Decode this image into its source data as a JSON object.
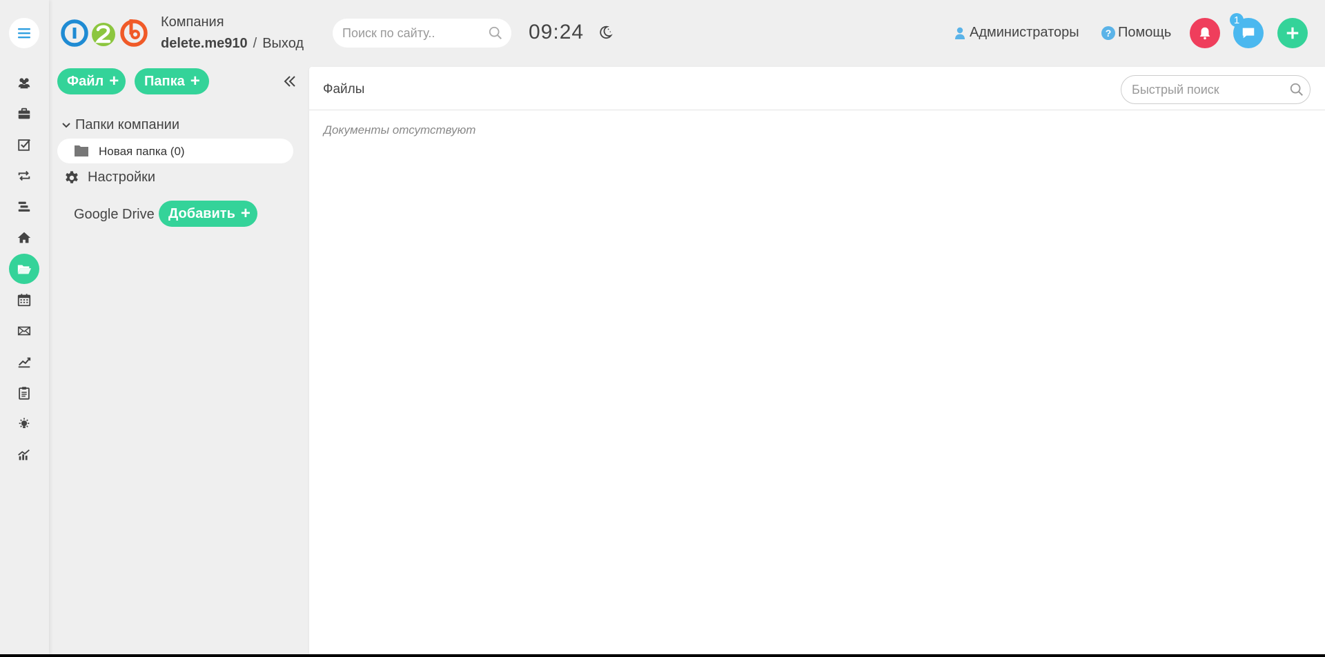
{
  "header": {
    "company_label": "Компания",
    "username": "delete.me910",
    "separator": "/",
    "logout_label": "Выход",
    "site_search_placeholder": "Поиск по сайту..",
    "clock": "09:24",
    "admins_label": "Администраторы",
    "help_label": "Помощь",
    "help_mark": "?",
    "chat_badge_count": "1"
  },
  "rail": {
    "items": [
      {
        "icon": "users-icon"
      },
      {
        "icon": "briefcase-icon"
      },
      {
        "icon": "checkbox-icon"
      },
      {
        "icon": "repeat-icon"
      },
      {
        "icon": "stack-icon"
      },
      {
        "icon": "home-icon"
      },
      {
        "icon": "folder-open-icon",
        "active": true
      },
      {
        "icon": "calendar-icon"
      },
      {
        "icon": "envelope-icon"
      },
      {
        "icon": "line-chart-icon"
      },
      {
        "icon": "clipboard-icon"
      },
      {
        "icon": "lightbulb-icon"
      },
      {
        "icon": "analytics-icon"
      }
    ]
  },
  "files_panel": {
    "file_button": "Файл",
    "folder_button": "Папка",
    "plus": "+",
    "tree_title": "Папки компании",
    "folder_item": "Новая папка (0)",
    "settings_label": "Настройки",
    "gdrive_label": "Google Drive",
    "add_button": "Добавить"
  },
  "main": {
    "title": "Файлы",
    "quick_search_placeholder": "Быстрый поиск",
    "empty_text": "Документы отсутствуют"
  },
  "colors": {
    "accent_green": "#34d399",
    "bell_red": "#ef3e5c",
    "chat_blue": "#4bb8ef",
    "logo_blue": "#1f8bd3",
    "logo_green": "#8cc63f",
    "logo_orange": "#f05a28"
  }
}
